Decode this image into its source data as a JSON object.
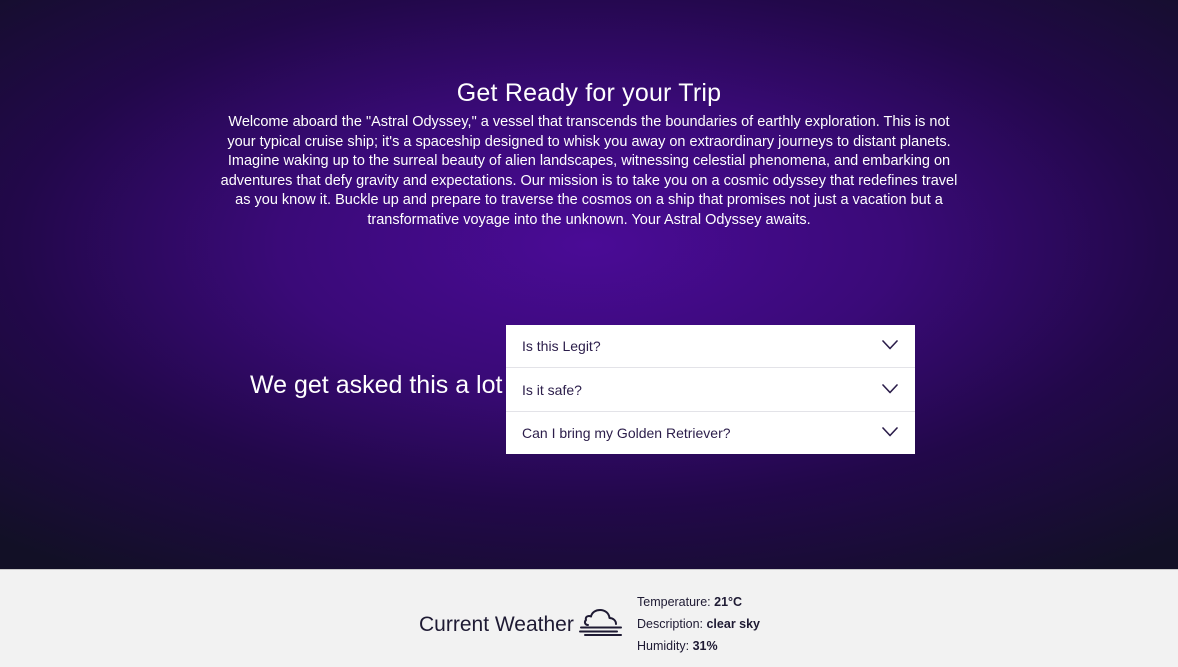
{
  "hero": {
    "title": "Get Ready for your Trip",
    "intro": "Welcome aboard the \"Astral Odyssey,\" a vessel that transcends the boundaries of earthly exploration. This is not your typical cruise ship; it's a spaceship designed to whisk you away on extraordinary journeys to distant planets. Imagine waking up to the surreal beauty of alien landscapes, witnessing celestial phenomena, and embarking on adventures that defy gravity and expectations. Our mission is to take you on a cosmic odyssey that redefines travel as you know it. Buckle up and prepare to traverse the cosmos on a ship that promises not just a vacation but a transformative voyage into the unknown. Your Astral Odyssey awaits."
  },
  "faq": {
    "heading": "We get asked this a lot",
    "items": [
      {
        "label": "Is this Legit?",
        "icon": "chevron-down-icon"
      },
      {
        "label": "Is it safe?",
        "icon": "chevron-down-icon"
      },
      {
        "label": "Can I bring my Golden Retriever?",
        "icon": "chevron-down-icon"
      }
    ]
  },
  "weather": {
    "title": "Current Weather",
    "icon": "fog-cloud-icon",
    "temperature_label": "Temperature:",
    "temperature_value": "21°C",
    "description_label": "Description:",
    "description_value": "clear sky",
    "humidity_label": "Humidity:",
    "humidity_value": "31%"
  },
  "colors": {
    "hero_accent": "#4a0b96",
    "text_dark": "#1e1a33",
    "footer_bg": "#f2f2f2"
  }
}
